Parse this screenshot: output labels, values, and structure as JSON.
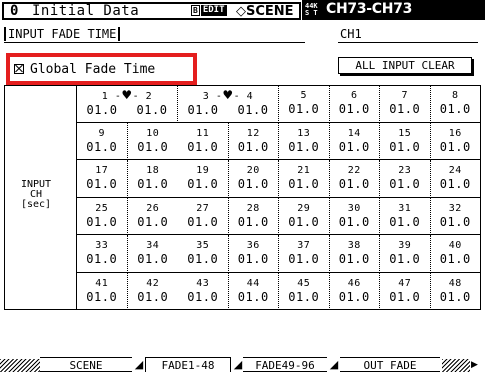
{
  "header": {
    "scene_number": "0",
    "scene_title": "Initial Data",
    "badge_b": "B",
    "badge_edit": "EDIT",
    "screen_label": "◇SCENE",
    "fs_top": "44K",
    "fs_bottom": "S T",
    "channel_range": "CH73-CH73"
  },
  "section": {
    "title": "INPUT FADE TIME",
    "channel": "CH1",
    "global_fade_label": "Global Fade Time",
    "all_clear_label": "ALL INPUT CLEAR"
  },
  "table": {
    "row_label": [
      "INPUT",
      "CH",
      "[sec]"
    ],
    "cells": [
      {
        "ch": "1 -",
        "pair": "- 2",
        "val": "01.0",
        "val2": "01.0",
        "linked": true
      },
      {
        "ch": "3 -",
        "pair": "- 4",
        "val": "01.0",
        "val2": "01.0",
        "linked": true
      },
      {
        "ch": "5",
        "val": "01.0"
      },
      {
        "ch": "6",
        "val": "01.0"
      },
      {
        "ch": "7",
        "val": "01.0"
      },
      {
        "ch": "8",
        "val": "01.0"
      },
      {
        "ch": "9",
        "val": "01.0"
      },
      {
        "ch": "10",
        "val": "01.0"
      },
      {
        "ch": "11",
        "val": "01.0"
      },
      {
        "ch": "12",
        "val": "01.0"
      },
      {
        "ch": "13",
        "val": "01.0"
      },
      {
        "ch": "14",
        "val": "01.0"
      },
      {
        "ch": "15",
        "val": "01.0"
      },
      {
        "ch": "16",
        "val": "01.0"
      },
      {
        "ch": "17",
        "val": "01.0"
      },
      {
        "ch": "18",
        "val": "01.0"
      },
      {
        "ch": "19",
        "val": "01.0"
      },
      {
        "ch": "20",
        "val": "01.0"
      },
      {
        "ch": "21",
        "val": "01.0"
      },
      {
        "ch": "22",
        "val": "01.0"
      },
      {
        "ch": "23",
        "val": "01.0"
      },
      {
        "ch": "24",
        "val": "01.0"
      },
      {
        "ch": "25",
        "val": "01.0"
      },
      {
        "ch": "26",
        "val": "01.0"
      },
      {
        "ch": "27",
        "val": "01.0"
      },
      {
        "ch": "28",
        "val": "01.0"
      },
      {
        "ch": "29",
        "val": "01.0"
      },
      {
        "ch": "30",
        "val": "01.0"
      },
      {
        "ch": "31",
        "val": "01.0"
      },
      {
        "ch": "32",
        "val": "01.0"
      },
      {
        "ch": "33",
        "val": "01.0"
      },
      {
        "ch": "34",
        "val": "01.0"
      },
      {
        "ch": "35",
        "val": "01.0"
      },
      {
        "ch": "36",
        "val": "01.0"
      },
      {
        "ch": "37",
        "val": "01.0"
      },
      {
        "ch": "38",
        "val": "01.0"
      },
      {
        "ch": "39",
        "val": "01.0"
      },
      {
        "ch": "40",
        "val": "01.0"
      },
      {
        "ch": "41",
        "val": "01.0"
      },
      {
        "ch": "42",
        "val": "01.0"
      },
      {
        "ch": "43",
        "val": "01.0"
      },
      {
        "ch": "44",
        "val": "01.0"
      },
      {
        "ch": "45",
        "val": "01.0"
      },
      {
        "ch": "46",
        "val": "01.0"
      },
      {
        "ch": "47",
        "val": "01.0"
      },
      {
        "ch": "48",
        "val": "01.0"
      }
    ]
  },
  "tabs": [
    {
      "label": "SCENE",
      "selected": false
    },
    {
      "label": "FADE1-48",
      "selected": true
    },
    {
      "label": "FADE49-96",
      "selected": false
    },
    {
      "label": "OUT FADE",
      "selected": false
    }
  ],
  "tab_arrow": "▶",
  "link_icon": "heart-link-icon",
  "highlight_color": "#e41e1e"
}
